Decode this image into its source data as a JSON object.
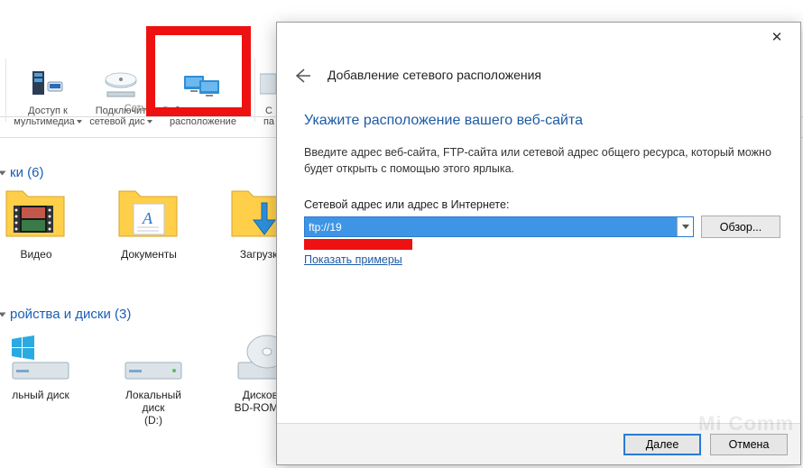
{
  "ribbon": {
    "group_label": "Сеть",
    "items": [
      {
        "line1": "Доступ к",
        "line2": "мультимедиа"
      },
      {
        "line1": "Подключит",
        "line2": "сетевой дис"
      },
      {
        "line1": "Добавить сетевое",
        "line2": "расположение"
      },
      {
        "line1": "С",
        "line2": "па"
      }
    ]
  },
  "sections": {
    "folders_title": "ки (6)",
    "drives_title": "ройства и диски (3)"
  },
  "folders": [
    {
      "label": "Видео"
    },
    {
      "label": "Документы"
    },
    {
      "label": "Загрузки"
    }
  ],
  "drives": [
    {
      "line1": "льный диск"
    },
    {
      "line1": "Локальный диск",
      "line2": "(D:)"
    },
    {
      "line1": "Дисковод",
      "line2": "BD-ROM (F:)"
    }
  ],
  "wizard": {
    "title": "Добавление сетевого расположения",
    "heading": "Укажите расположение вашего веб-сайта",
    "description": "Введите адрес веб-сайта, FTP-сайта или сетевой адрес общего ресурса, который можно будет открыть с помощью этого ярлыка.",
    "field_label": "Сетевой адрес или адрес в Интернете:",
    "address_value": "ftp://19",
    "browse": "Обзор...",
    "examples_link": "Показать примеры",
    "next": "Далее",
    "cancel": "Отмена"
  },
  "watermark": "Mi Comm"
}
